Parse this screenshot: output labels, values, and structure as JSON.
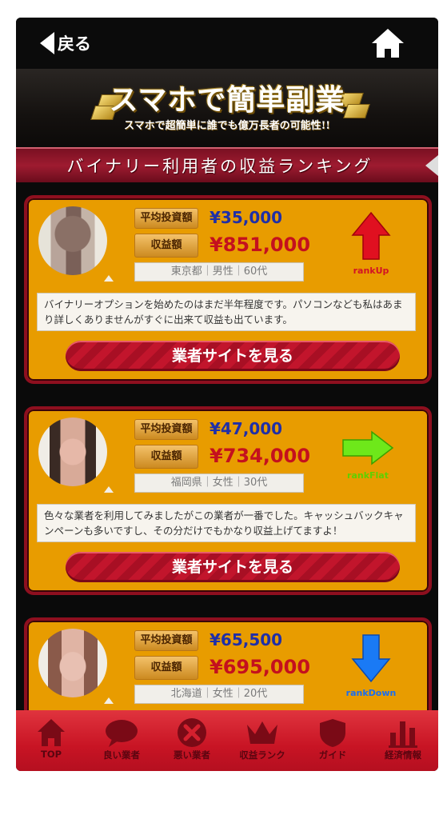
{
  "header": {
    "back_label": "戻る"
  },
  "banner": {
    "title": "スマホで簡単副業",
    "subtitle": "スマホで超簡単に誰でも億万長者の可能性!!"
  },
  "section": {
    "title": "バイナリー利用者の収益ランキング"
  },
  "labels": {
    "invest": "平均投資額",
    "profit": "収益額"
  },
  "cards": [
    {
      "invest": "¥35,000",
      "profit": "¥851,000",
      "meta": "東京都｜男性｜60代",
      "rank_label": "rankUp",
      "rank_color": "#d21424",
      "comment": "バイナリーオプションを始めたのはまだ半年程度です。パソコンなども私はあまり詳しくありませんがすぐに出来て収益も出ています。",
      "cta": "業者サイトを見る"
    },
    {
      "invest": "¥47,000",
      "profit": "¥734,000",
      "meta": "福岡県｜女性｜30代",
      "rank_label": "rankFlat",
      "rank_color": "#5fd000",
      "comment": "色々な業者を利用してみましたがこの業者が一番でした。キャッシュバックキャンペーンも多いですし、その分だけでもかなり収益上げてますよ！",
      "cta": "業者サイトを見る"
    },
    {
      "invest": "¥65,500",
      "profit": "¥695,000",
      "meta": "北海道｜女性｜20代",
      "rank_label": "rankDown",
      "rank_color": "#1a6ef0"
    }
  ],
  "nav": {
    "top": "TOP",
    "good": "良い業者",
    "bad": "悪い業者",
    "ranking": "収益ランク",
    "guide": "ガイド",
    "economy": "経済情報"
  }
}
